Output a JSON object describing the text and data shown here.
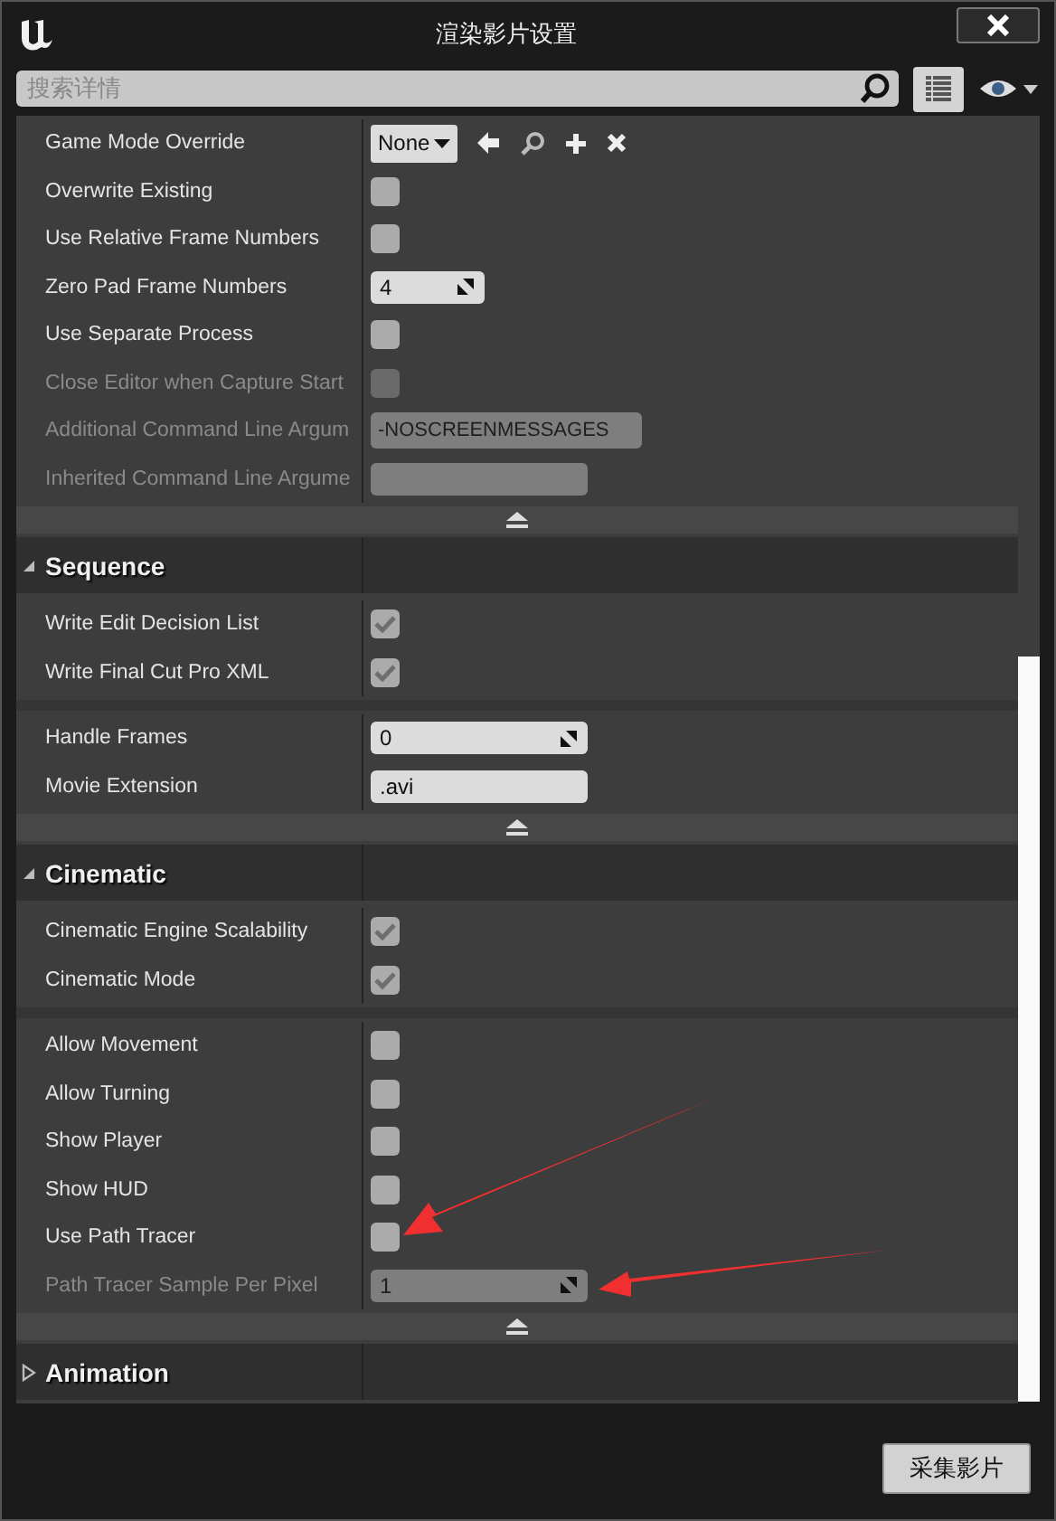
{
  "window": {
    "title": "渲染影片设置"
  },
  "search": {
    "placeholder": "搜索详情"
  },
  "sections": [
    {
      "blocks": [
        [
          {
            "kind": "combo",
            "label": "Game Mode Override",
            "value": "None",
            "disabled": false
          },
          {
            "kind": "checkbox",
            "label": "Overwrite Existing",
            "checked": false,
            "disabled": false
          },
          {
            "kind": "checkbox",
            "label": "Use Relative Frame Numbers",
            "checked": false,
            "disabled": false
          },
          {
            "kind": "spin_short",
            "label": "Zero Pad Frame Numbers",
            "value": "4",
            "disabled": false
          },
          {
            "kind": "checkbox",
            "label": "Use Separate Process",
            "checked": false,
            "disabled": false
          },
          {
            "kind": "checkbox",
            "label": "Close Editor when Capture Start",
            "checked": false,
            "disabled": true
          },
          {
            "kind": "text_long",
            "label": "Additional Command Line Argum",
            "value": "-NOSCREENMESSAGES",
            "disabled": true
          },
          {
            "kind": "text",
            "label": "Inherited Command Line Argume",
            "disabled": true
          }
        ]
      ]
    },
    {
      "title": "Sequence",
      "expanded": true,
      "blocks": [
        [
          {
            "kind": "checkbox",
            "label": "Write Edit Decision List",
            "checked": true,
            "disabled": false
          },
          {
            "kind": "checkbox",
            "label": "Write Final Cut Pro XML",
            "checked": true,
            "disabled": false
          }
        ],
        [
          {
            "kind": "spin",
            "label": "Handle Frames",
            "value": "0",
            "disabled": false
          },
          {
            "kind": "text",
            "label": "Movie Extension",
            "value": ".avi",
            "disabled": false
          }
        ]
      ]
    },
    {
      "title": "Cinematic",
      "expanded": true,
      "blocks": [
        [
          {
            "kind": "checkbox",
            "label": "Cinematic Engine Scalability",
            "checked": true,
            "disabled": false
          },
          {
            "kind": "checkbox",
            "label": "Cinematic Mode",
            "checked": true,
            "disabled": false
          }
        ],
        [
          {
            "kind": "checkbox",
            "label": "Allow Movement",
            "checked": false,
            "disabled": false
          },
          {
            "kind": "checkbox",
            "label": "Allow Turning",
            "checked": false,
            "disabled": false
          },
          {
            "kind": "checkbox",
            "label": "Show Player",
            "checked": false,
            "disabled": false
          },
          {
            "kind": "checkbox",
            "label": "Show HUD",
            "checked": false,
            "disabled": false
          },
          {
            "kind": "checkbox",
            "label": "Use Path Tracer",
            "checked": false,
            "disabled": false
          },
          {
            "kind": "spin",
            "label": "Path Tracer Sample Per Pixel",
            "value": "1",
            "disabled": true
          }
        ]
      ]
    },
    {
      "title": "Animation",
      "expanded": false
    }
  ],
  "buttons": [
    {
      "label": "采集影片"
    }
  ]
}
